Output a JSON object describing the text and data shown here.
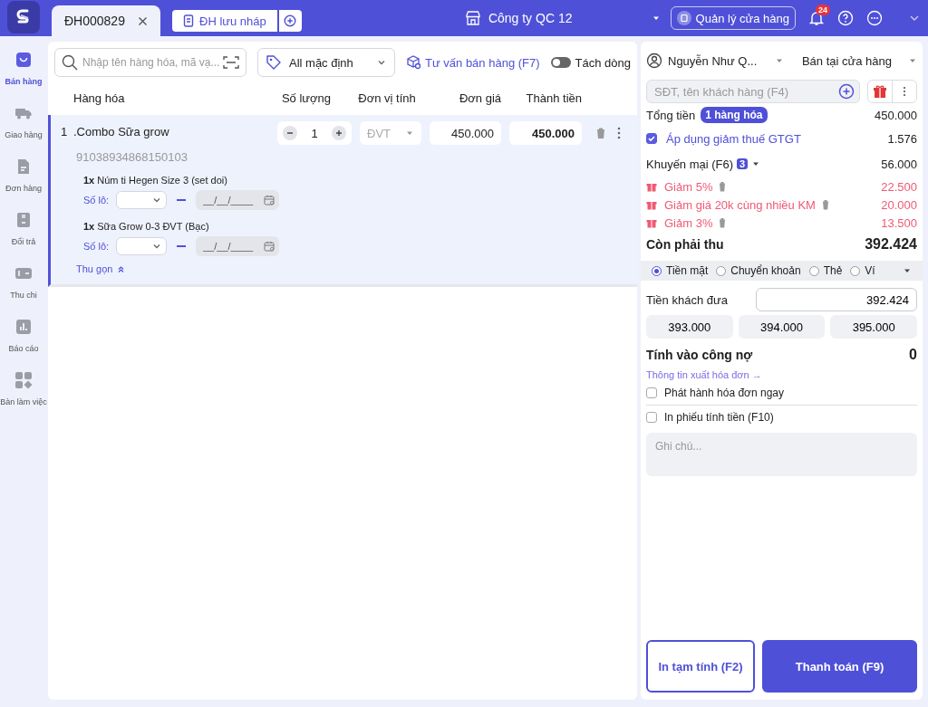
{
  "header": {
    "tabs": [
      {
        "label": "ĐH000829",
        "selected": true
      }
    ],
    "draft_button": "ĐH lưu nháp",
    "store": "Công ty QC 12",
    "manage_button": "Quản lý cửa hàng",
    "notification_count": "24"
  },
  "sidebar": {
    "items": [
      {
        "label": "Bán hàng",
        "selected": true
      },
      {
        "label": "Giao hàng",
        "selected": false
      },
      {
        "label": "Đơn hàng",
        "selected": false
      },
      {
        "label": "Đổi trả",
        "selected": false
      },
      {
        "label": "Thu chi",
        "selected": false
      },
      {
        "label": "Báo cáo",
        "selected": false
      },
      {
        "label": "Bàn làm việc",
        "selected": false
      }
    ]
  },
  "toolbar": {
    "search": {
      "placeholder": "Nhập tên hàng hóa, mã vạ..."
    },
    "price_list": "All mặc định",
    "advice_link": "Tư vấn bán hàng (F7)",
    "split_toggle": {
      "label": "Tách dòng",
      "on": false
    }
  },
  "table": {
    "columns": [
      "Hàng hóa",
      "Số lượng",
      "Đơn vị tính",
      "Đơn giá",
      "Thành tiền"
    ],
    "rows": [
      {
        "selected": true,
        "index": "1",
        "name": ".Combo Sữa grow",
        "barcode": "91038934868150103",
        "quantity": "1",
        "unit_placeholder": "ĐVT",
        "price": "450.000",
        "total": "450.000",
        "components": [
          {
            "quantity": "1x",
            "name": "Núm ti Hegen Size 3 (set doi)",
            "lot_label": "Số lô:",
            "date_placeholder": "__/__/____"
          },
          {
            "quantity": "1x",
            "name": "Sữa Grow 0-3 ĐVT (Bạc)",
            "lot_label": "Số lô:",
            "date_placeholder": "__/__/____"
          }
        ],
        "collapse_link": "Thu gọn"
      }
    ]
  },
  "payment": {
    "seller": "Nguyễn Như Q...",
    "channel": "Bán tại cửa hàng",
    "customer_search": {
      "placeholder": "SĐT, tên khách hàng (F4)"
    },
    "total": {
      "label": "Tổng tiền",
      "badge": "1 hàng hóa",
      "value": "450.000"
    },
    "vat": {
      "label": "Áp dụng giảm thuế GTGT",
      "checked": true,
      "value": "1.576"
    },
    "promotion": {
      "label": "Khuyến mại (F6)",
      "count": "3",
      "value": "56.000"
    },
    "promotions": [
      {
        "name": "Giảm 5%",
        "amount": "22.500"
      },
      {
        "name": "Giảm giá 20k cùng nhiều KM",
        "amount": "20.000"
      },
      {
        "name": "Giảm 3%",
        "amount": "13.500"
      }
    ],
    "due": {
      "label": "Còn phải thu",
      "value": "392.424"
    },
    "methods": [
      {
        "label": "Tiền mặt",
        "selected": true
      },
      {
        "label": "Chuyển khoản",
        "selected": false
      },
      {
        "label": "Thẻ",
        "selected": false
      },
      {
        "label": "Ví",
        "selected": false
      }
    ],
    "cash_given": {
      "label": "Tiền khách đưa",
      "value": "392.424"
    },
    "quick_amounts": [
      "393.000",
      "394.000",
      "395.000"
    ],
    "debt": {
      "label": "Tính vào công nợ",
      "value": "0"
    },
    "invoice_link": "Thông tin xuất hóa đơn →",
    "options": [
      {
        "label": "Phát hành hóa đơn ngay",
        "checked": false
      },
      {
        "label": "In phiếu tính tiền (F10)",
        "checked": false
      }
    ],
    "note": {
      "placeholder": "Ghi chú..."
    },
    "buttons": [
      {
        "label": "In tạm tính (F2)",
        "kind": "outline"
      },
      {
        "label": "Thanh toán (F9)",
        "kind": "primary"
      }
    ]
  }
}
